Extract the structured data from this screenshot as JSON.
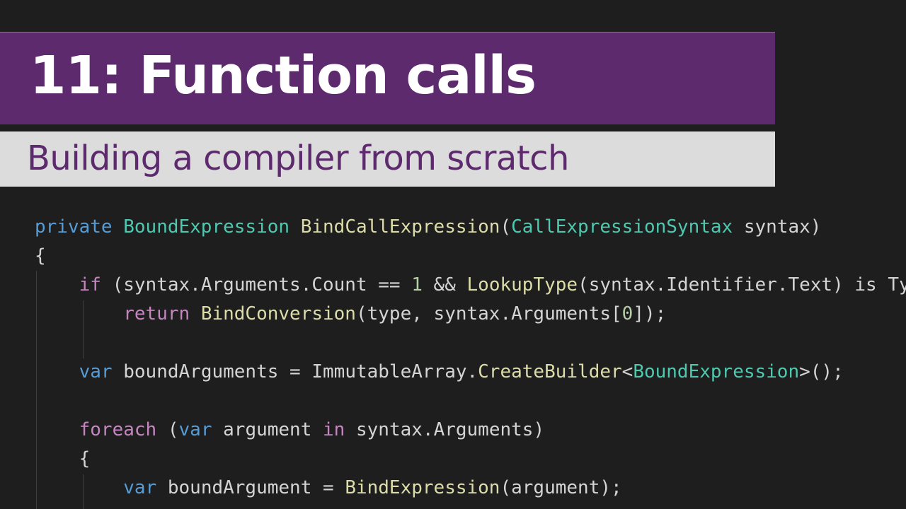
{
  "header": {
    "title": "11: Function calls",
    "subtitle": "Building a compiler from scratch"
  },
  "theme": {
    "banner_color": "#5e2a6e",
    "subtitle_bg": "#dcdcdc",
    "editor_bg": "#1e1e1e",
    "keyword_color": "#569cd6",
    "control_color": "#c586c0",
    "type_color": "#4ec9b0",
    "function_color": "#dcdcaa",
    "number_color": "#b5cea8",
    "text_color": "#d4d4d4"
  },
  "code": {
    "lines": [
      [
        {
          "t": "private",
          "c": "kw"
        },
        {
          "t": " ",
          "c": "txt"
        },
        {
          "t": "BoundExpression",
          "c": "type"
        },
        {
          "t": " ",
          "c": "txt"
        },
        {
          "t": "BindCallExpression",
          "c": "fn"
        },
        {
          "t": "(",
          "c": "txt"
        },
        {
          "t": "CallExpressionSyntax",
          "c": "type"
        },
        {
          "t": " syntax)",
          "c": "txt"
        }
      ],
      [
        {
          "t": "{",
          "c": "txt"
        }
      ],
      [
        {
          "t": "    ",
          "c": "txt"
        },
        {
          "t": "if",
          "c": "ctrl"
        },
        {
          "t": " (syntax.Arguments.Count == ",
          "c": "txt"
        },
        {
          "t": "1",
          "c": "num"
        },
        {
          "t": " && ",
          "c": "txt"
        },
        {
          "t": "LookupType",
          "c": "fn"
        },
        {
          "t": "(syntax.Identifier.Text) is TypeSymbol type)",
          "c": "txt"
        }
      ],
      [
        {
          "t": "        ",
          "c": "txt"
        },
        {
          "t": "return",
          "c": "ctrl"
        },
        {
          "t": " ",
          "c": "txt"
        },
        {
          "t": "BindConversion",
          "c": "fn"
        },
        {
          "t": "(type, syntax.Arguments[",
          "c": "txt"
        },
        {
          "t": "0",
          "c": "num"
        },
        {
          "t": "]);",
          "c": "txt"
        }
      ],
      [],
      [
        {
          "t": "    ",
          "c": "txt"
        },
        {
          "t": "var",
          "c": "kw"
        },
        {
          "t": " boundArguments = ImmutableArray.",
          "c": "txt"
        },
        {
          "t": "CreateBuilder",
          "c": "fn"
        },
        {
          "t": "<",
          "c": "txt"
        },
        {
          "t": "BoundExpression",
          "c": "type"
        },
        {
          "t": ">();",
          "c": "txt"
        }
      ],
      [],
      [
        {
          "t": "    ",
          "c": "txt"
        },
        {
          "t": "foreach",
          "c": "ctrl"
        },
        {
          "t": " (",
          "c": "txt"
        },
        {
          "t": "var",
          "c": "kw"
        },
        {
          "t": " argument ",
          "c": "txt"
        },
        {
          "t": "in",
          "c": "ctrl"
        },
        {
          "t": " syntax.Arguments)",
          "c": "txt"
        }
      ],
      [
        {
          "t": "    {",
          "c": "txt"
        }
      ],
      [
        {
          "t": "        ",
          "c": "txt"
        },
        {
          "t": "var",
          "c": "kw"
        },
        {
          "t": " boundArgument = ",
          "c": "txt"
        },
        {
          "t": "BindExpression",
          "c": "fn"
        },
        {
          "t": "(argument);",
          "c": "txt"
        }
      ]
    ]
  }
}
